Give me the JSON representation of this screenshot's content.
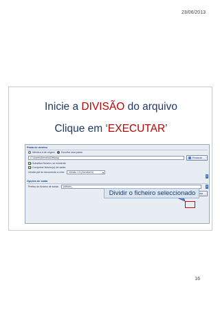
{
  "page": {
    "date": "23/06/2013",
    "number": "16"
  },
  "slide": {
    "title_line1": {
      "a": "Inicie a ",
      "b": "DIVISÃO",
      "c": " do arquivo"
    },
    "title_line2": {
      "a": "Clique em ‘",
      "b": "EXECUTAR",
      "c": "’"
    },
    "caption": "Dividir o ficheiro seleccionado"
  },
  "dialog": {
    "section_destino": "Pasta de destino",
    "radio_same": "Idêntica à de origem",
    "radio_choose": "Escolha uma pasta",
    "path_value": "C:\\Users\\Ahmelia\\Desktop",
    "browse_label": "Procurar",
    "chk_replace": "Substituir ficheiro, se existente",
    "chk_compress": "Comprimir ficheiro(s) de saída",
    "version_label": "Versão pdf do documento a criar:",
    "version_value": "Versão 1.5 (Acrobat 6)",
    "section_saida": "Opções de saída",
    "prefix_label": "Prefixo do ficheiro de saída:",
    "prefix_value": "pdfsam_",
    "run_label": "Executar",
    "help_glyph": "?"
  },
  "colors": {
    "title": "#1f3864",
    "accent_red": "#c00000",
    "arrow": "#5b7ec4"
  }
}
